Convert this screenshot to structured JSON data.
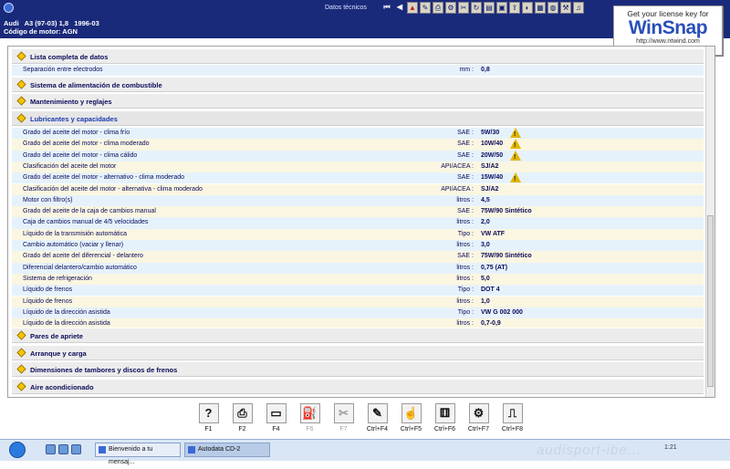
{
  "title_bar": {
    "document_title": "Datos técnicos",
    "toolbar_icons": [
      "nav-first",
      "nav-prev",
      "warning",
      "notes",
      "print",
      "settings",
      "tools",
      "refresh",
      "chart",
      "book",
      "export",
      "palette",
      "calendar",
      "globe",
      "engine",
      "bell"
    ]
  },
  "vehicle": {
    "line1": "Audi   A3 (97-03) 1,8   1996-03",
    "line2": "Código de motor: AGN"
  },
  "watermark": {
    "top": "Get your license key for",
    "logo": "WinSnap",
    "url": "http://www.ntwind.com"
  },
  "sections": {
    "lista": "Lista completa de datos",
    "combustible": "Sistema de alimentación de combustible",
    "mantenimiento": "Mantenimiento y reglajes",
    "lubricantes": "Lubricantes y capacidades",
    "pares": "Pares de apriete",
    "arranque": "Arranque y carga",
    "dimensiones": "Dimensiones de tambores y discos de frenos",
    "aire": "Aire acondicionado"
  },
  "electrode_row": {
    "label": "Separación entre electrodos",
    "unit": "mm :",
    "value": "0,8"
  },
  "rows": [
    {
      "label": "Grado del aceite del motor - clima frío",
      "unit": "SAE :",
      "value": "5W/30",
      "warning": true
    },
    {
      "label": "Grado del aceite del motor - clima moderado",
      "unit": "SAE :",
      "value": "10W/40",
      "warning": true
    },
    {
      "label": "Grado del aceite del motor - clima cálido",
      "unit": "SAE :",
      "value": "20W/50",
      "warning": true
    },
    {
      "label": "Clasificación del aceite del motor",
      "unit": "API/ACEA :",
      "value": "SJ/A2",
      "warning": false
    },
    {
      "label": "Grado del aceite del motor - alternativo - clima moderado",
      "unit": "SAE :",
      "value": "15W/40",
      "warning": true
    },
    {
      "label": "Clasificación del aceite del motor - alternativa - clima moderado",
      "unit": "API/ACEA :",
      "value": "SJ/A2",
      "warning": false
    },
    {
      "label": "Motor con filtro(s)",
      "unit": "litros :",
      "value": "4,5",
      "warning": false
    },
    {
      "label": "Grado del aceite de la caja de cambios manual",
      "unit": "SAE :",
      "value": "75W/90  Sintético",
      "warning": false
    },
    {
      "label": "Caja de cambios manual de 4/5 velocidades",
      "unit": "litros :",
      "value": "2,0",
      "warning": false
    },
    {
      "label": "Líquido de la transmisión automática",
      "unit": "Tipo :",
      "value": "VW ATF",
      "warning": false
    },
    {
      "label": "Cambio automático (vaciar y llenar)",
      "unit": "litros :",
      "value": "3,0",
      "warning": false
    },
    {
      "label": "Grado del aceite del diferencial - delantero",
      "unit": "SAE :",
      "value": "75W/90  Sintético",
      "warning": false
    },
    {
      "label": "Diferencial delantero/cambio automático",
      "unit": "litros :",
      "value": "0,75 (AT)",
      "warning": false
    },
    {
      "label": "Sistema de refrigeración",
      "unit": "litros :",
      "value": "5,0",
      "warning": false
    },
    {
      "label": "Líquido de frenos",
      "unit": "Tipo :",
      "value": "DOT 4",
      "warning": false
    },
    {
      "label": "Líquido de frenos",
      "unit": "litros :",
      "value": "1,0",
      "warning": false
    },
    {
      "label": "Líquido de la dirección asistida",
      "unit": "Tipo :",
      "value": "VW G 002 000",
      "warning": false
    },
    {
      "label": "Líquido de la dirección asistida",
      "unit": "litros :",
      "value": "0,7-0,9",
      "warning": false
    }
  ],
  "function_keys": [
    {
      "label": "F1",
      "icon": "help-icon",
      "glyph": "?",
      "enabled": true
    },
    {
      "label": "F2",
      "icon": "print-icon",
      "glyph": "⎙",
      "enabled": true
    },
    {
      "label": "F4",
      "icon": "screen-icon",
      "glyph": "▭",
      "enabled": true
    },
    {
      "label": "F6",
      "icon": "fill-icon",
      "glyph": "⛽",
      "enabled": false
    },
    {
      "label": "F7",
      "icon": "tools-icon",
      "glyph": "✂",
      "enabled": false
    },
    {
      "label": "Ctrl+F4",
      "icon": "notes-icon",
      "glyph": "✎",
      "enabled": true
    },
    {
      "label": "Ctrl+F5",
      "icon": "hand-icon",
      "glyph": "☝",
      "enabled": true
    },
    {
      "label": "Ctrl+F6",
      "icon": "dice-icon",
      "glyph": "⚅",
      "enabled": true
    },
    {
      "label": "Ctrl+F7",
      "icon": "parts-icon",
      "glyph": "⚙",
      "enabled": true
    },
    {
      "label": "Ctrl+F8",
      "icon": "door-icon",
      "glyph": "⎍",
      "enabled": true
    }
  ],
  "taskbar": {
    "task1": "Bienvenido a tu mensaj...",
    "task2": "Autodata CD-2",
    "background_text": "audisport-ibe...",
    "tray_time": "1:21"
  },
  "colors": {
    "header_bg": "#1a2a7a",
    "row_cyan": "#e6f2fb",
    "row_yellow": "#fbf6e1",
    "warning": "#e2b600"
  }
}
